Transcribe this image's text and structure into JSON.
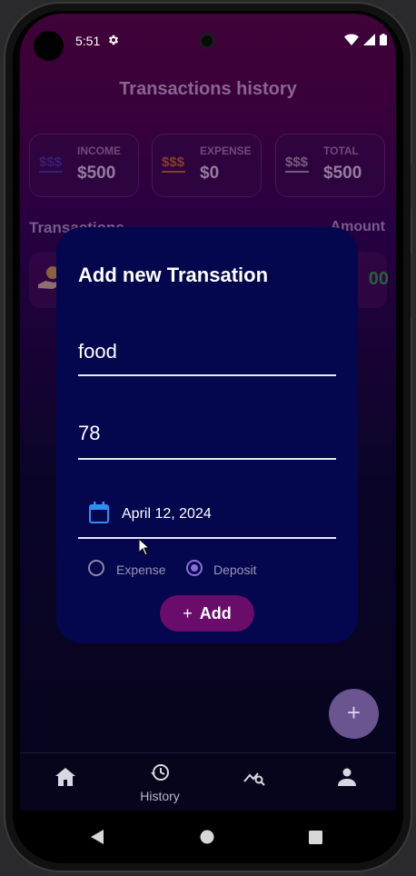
{
  "status_bar": {
    "time": "5:51"
  },
  "app": {
    "title": "Transactions history"
  },
  "summary": [
    {
      "label": "INCOME",
      "value": "$500",
      "icon_color": "#3a3aa8"
    },
    {
      "label": "EXPENSE",
      "value": "$0",
      "icon_color": "#d07020"
    },
    {
      "label": "TOTAL",
      "value": "$500",
      "icon_color": "#a8a8b0"
    }
  ],
  "summary_icon_text": "$$$",
  "transactions": {
    "header_left": "Transactions",
    "header_right": "Amount",
    "amount_visible": "00"
  },
  "dialog": {
    "title": "Add new Transation",
    "name_value": "food",
    "amount_value": "78",
    "date_value": "April 12, 2024",
    "radio_expense": "Expense",
    "radio_deposit": "Deposit",
    "selected": "Deposit",
    "add_label": "Add",
    "add_icon": "+"
  },
  "fab_icon": "+",
  "bottom_nav": {
    "history_label": "History"
  },
  "colors": {
    "accent": "#6a0c6a",
    "dialog_bg": "#04064e",
    "amount_green": "#2fae3c",
    "date_icon": "#2f8ff0"
  }
}
